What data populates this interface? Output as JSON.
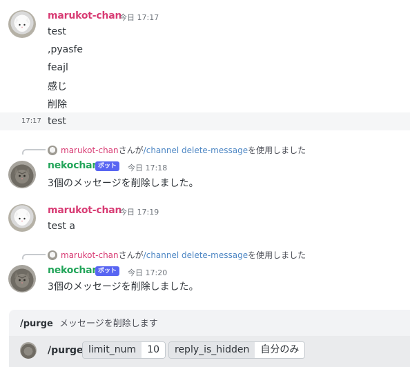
{
  "messages": [
    {
      "user": "marukot-chan",
      "time": "今日 17:17",
      "lines": [
        "test",
        ",pyasfe",
        "feajl",
        "感じ",
        "削除"
      ]
    },
    {
      "hover_time": "17:17",
      "text": "test"
    },
    {
      "reply_user": "marukot-chan",
      "reply_mid": "さんが",
      "reply_cmd": "/channel delete-message",
      "reply_tail": "を使用しました",
      "user": "nekochan",
      "badge": "ボット",
      "time": "今日 17:18",
      "text": "3個のメッセージを削除しました。"
    },
    {
      "user": "marukot-chan",
      "time": "今日 17:19",
      "text": "test a"
    },
    {
      "reply_user": "marukot-chan",
      "reply_mid": "さんが",
      "reply_cmd": "/channel delete-message",
      "reply_tail": "を使用しました",
      "user": "nekochan",
      "badge": "ボット",
      "time": "今日 17:20",
      "text": "3個のメッセージを削除しました。"
    }
  ],
  "command": {
    "name": "/purge",
    "description": "メッセージを削除します",
    "input_name": "/purge",
    "options": [
      {
        "key": "limit_num",
        "value": "10"
      },
      {
        "key": "reply_is_hidden",
        "value": "自分のみ"
      }
    ]
  },
  "colors": {
    "user_pink": "#d83c74",
    "user_green": "#23a55a",
    "bot_badge": "#5865f2",
    "command_link": "#4e87c4"
  }
}
